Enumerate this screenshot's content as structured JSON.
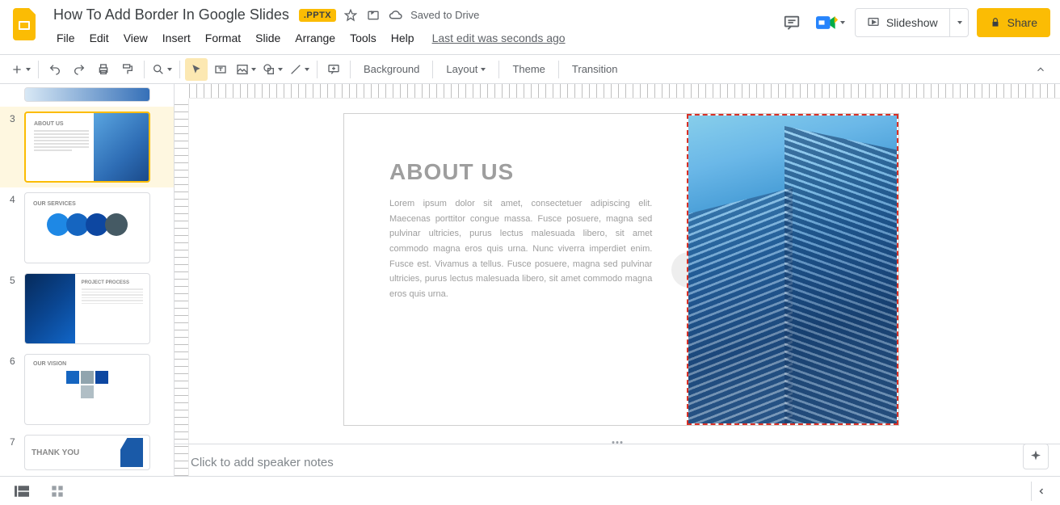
{
  "header": {
    "doc_title": "How To Add Border In Google Slides",
    "file_badge": ".PPTX",
    "saved_text": "Saved to Drive",
    "last_edit": "Last edit was seconds ago",
    "slideshow": "Slideshow",
    "share": "Share"
  },
  "menus": [
    "File",
    "Edit",
    "View",
    "Insert",
    "Format",
    "Slide",
    "Arrange",
    "Tools",
    "Help"
  ],
  "toolbar_text": {
    "background": "Background",
    "layout": "Layout",
    "theme": "Theme",
    "transition": "Transition"
  },
  "thumbs": {
    "n3": "3",
    "n4": "4",
    "n5": "5",
    "n6": "6",
    "n7": "7",
    "t3_title": "ABOUT US",
    "t4_title": "OUR SERVICES",
    "t5_title": "PROJECT PROCESS",
    "t6_title": "OUR VISION",
    "t7_title": "THANK YOU"
  },
  "slide": {
    "title": "ABOUT US",
    "body": "Lorem ipsum dolor sit amet, consectetuer adipiscing elit. Maecenas porttitor congue massa. Fusce posuere, magna sed pulvinar ultricies, purus lectus malesuada libero, sit amet commodo magna eros quis urna. Nunc viverra imperdiet enim. Fusce est. Vivamus a tellus. Fusce posuere, magna sed pulvinar ultricies, purus lectus malesuada libero, sit amet commodo magna eros quis urna."
  },
  "notes": {
    "placeholder": "Click to add speaker notes"
  }
}
